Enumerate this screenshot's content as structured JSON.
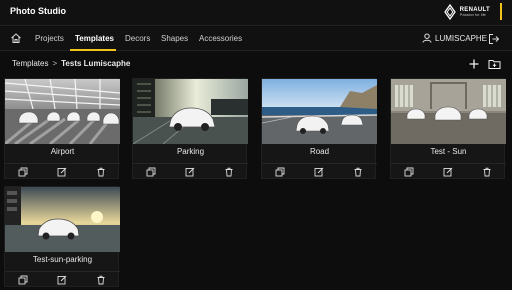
{
  "app": {
    "title": "Photo Studio"
  },
  "brand": {
    "name": "RENAULT",
    "tagline": "Passion for life",
    "logo_icon": "renault-logo-icon",
    "accent": "#f0c419"
  },
  "nav": {
    "home_icon": "home-icon",
    "items": [
      {
        "label": "Projects",
        "active": false
      },
      {
        "label": "Templates",
        "active": true
      },
      {
        "label": "Decors",
        "active": false
      },
      {
        "label": "Shapes",
        "active": false
      },
      {
        "label": "Accessories",
        "active": false
      }
    ],
    "user": {
      "name": "LUMISCAPHE",
      "icon": "user-icon"
    },
    "logout_icon": "logout-icon"
  },
  "breadcrumb": {
    "root": "Templates",
    "separator": ">",
    "current": "Tests Lumiscaphe"
  },
  "toolbar": {
    "add_icon": "plus-icon",
    "new_folder_icon": "folder-plus-icon"
  },
  "templates": [
    {
      "label": "Airport",
      "scene": "airport"
    },
    {
      "label": "Parking",
      "scene": "parking"
    },
    {
      "label": "Road",
      "scene": "road"
    },
    {
      "label": "Test - Sun",
      "scene": "warehouse"
    },
    {
      "label": "Test-sun-parking",
      "scene": "sunset"
    }
  ],
  "card_actions": {
    "duplicate_icon": "duplicate-icon",
    "edit_icon": "edit-icon",
    "delete_icon": "trash-icon"
  }
}
